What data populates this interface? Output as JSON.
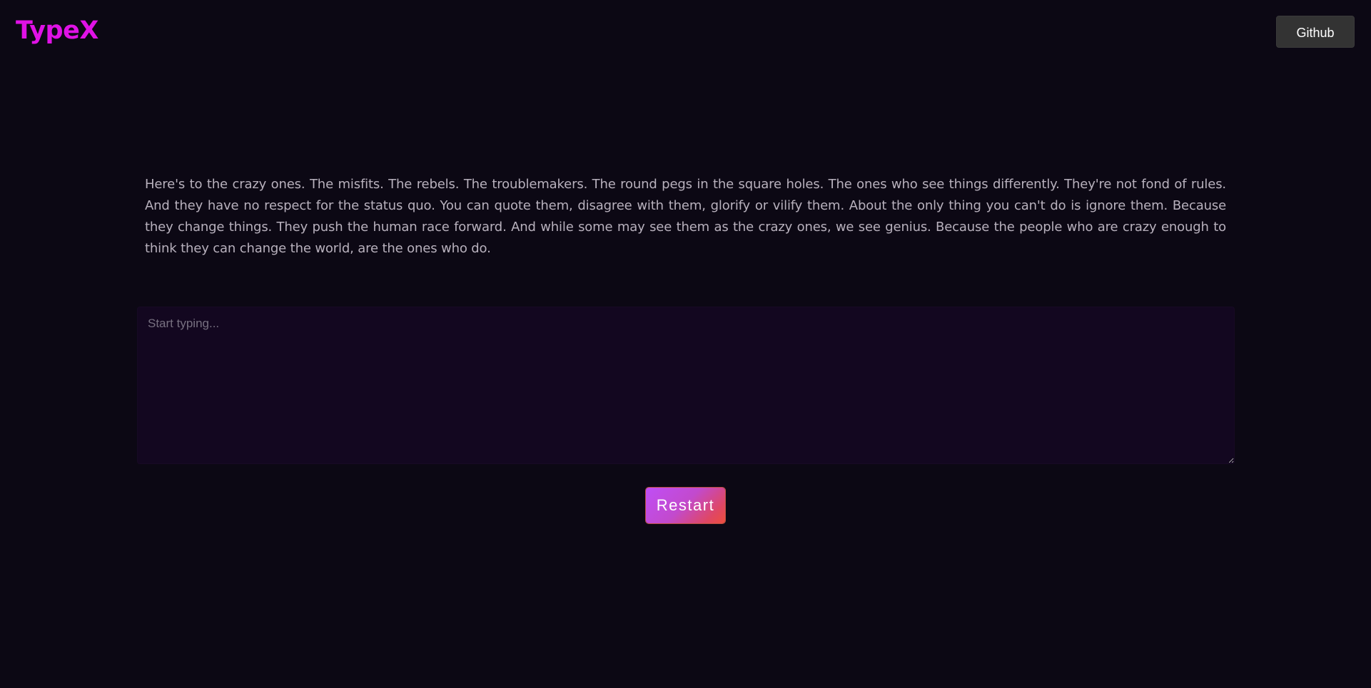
{
  "brand": {
    "name": "TypeX",
    "color": "#e012e6"
  },
  "header": {
    "github_label": "Github"
  },
  "passage": {
    "text": "Here's to the crazy ones. The misfits. The rebels. The troublemakers. The round pegs in the square holes. The ones who see things differently. They're not fond of rules. And they have no respect for the status quo. You can quote them, disagree with them, glorify or vilify them. About the only thing you can't do is ignore them. Because they change things. They push the human race forward. And while some may see them as the crazy ones, we see genius. Because the people who are crazy enough to think they can change the world, are the ones who do."
  },
  "typing_input": {
    "value": "",
    "placeholder": "Start typing..."
  },
  "restart": {
    "label": "Restart"
  },
  "colors": {
    "background": "#0c0814",
    "text": "#b8b1bd",
    "input_background": "#130720",
    "button_gradient_start": "#c04ef6",
    "button_gradient_end": "#ee4e3d"
  }
}
